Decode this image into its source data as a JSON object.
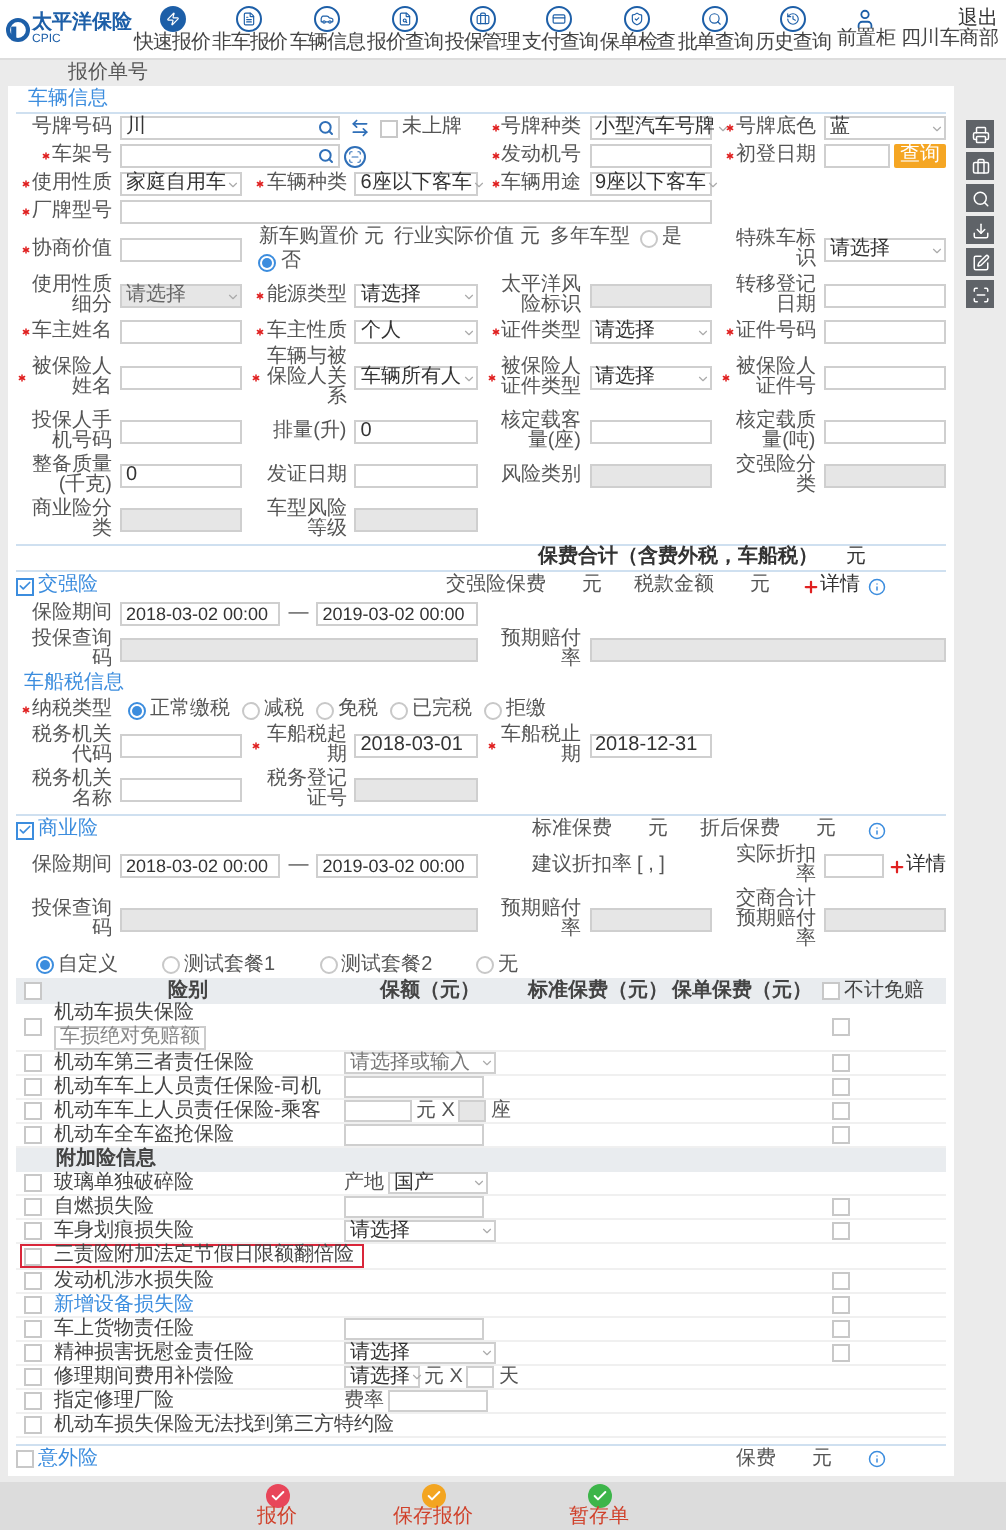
{
  "header": {
    "logo_text": "太平洋保险",
    "logo_sub": "CPIC",
    "nav": [
      {
        "label": "快速报价",
        "selected": true
      },
      {
        "label": "非车报价",
        "selected": false
      },
      {
        "label": "车辆信息",
        "selected": false
      },
      {
        "label": "报价查询",
        "selected": false
      },
      {
        "label": "投保管理",
        "selected": false
      },
      {
        "label": "支付查询",
        "selected": false
      },
      {
        "label": "保单检查",
        "selected": false
      },
      {
        "label": "批单查询",
        "selected": false
      },
      {
        "label": "历史查询",
        "selected": false
      }
    ],
    "user_label": "前置柜",
    "logout": "退出",
    "org": "四川车商部"
  },
  "quote_no_label": "报价单号",
  "vehicle": {
    "tab": "车辆信息",
    "rows": [
      [
        {
          "kind": "plate_lookup",
          "label": "号牌号码",
          "value": "川",
          "checkbox": {
            "label": "未上牌",
            "checked": false
          }
        },
        {
          "kind": "select",
          "label": "号牌种类",
          "required": true,
          "value": "小型汽车号牌"
        },
        {
          "kind": "select",
          "label": "号牌底色",
          "required": true,
          "value": "蓝"
        }
      ],
      [
        {
          "kind": "vin_lookup",
          "label": "车架号",
          "required": true
        },
        {
          "kind": "input",
          "label": "发动机号",
          "required": true
        },
        {
          "kind": "input",
          "label": "初登日期",
          "required": true,
          "button": "查询"
        }
      ],
      [
        {
          "kind": "select",
          "label": "使用性质",
          "required": true,
          "value": "家庭自用车"
        },
        {
          "kind": "select",
          "label": "车辆种类",
          "required": true,
          "value": "6座以下客车"
        },
        {
          "kind": "select",
          "label": "车辆用途",
          "required": true,
          "value": "9座以下客车"
        }
      ],
      [
        {
          "kind": "wide",
          "label": "厂牌型号",
          "required": true
        }
      ],
      [
        {
          "kind": "input",
          "label": "协商价值",
          "required": true
        },
        {
          "kind": "inline",
          "parts": [
            "新车购置价 元",
            "行业实际价值 元"
          ],
          "radio_label": "多年车型",
          "options": [
            {
              "label": "是",
              "selected": false
            },
            {
              "label": "否",
              "selected": true
            }
          ]
        },
        {
          "kind": "select",
          "label": "特殊车标识",
          "value": "请选择"
        }
      ],
      [
        {
          "kind": "select",
          "label": "使用性质细分",
          "value": "请选择",
          "disabled": true
        },
        {
          "kind": "select",
          "label": "能源类型",
          "required": true,
          "value": "请选择"
        },
        {
          "kind": "readonly",
          "label": "太平洋风险标识"
        },
        {
          "kind": "input",
          "label": "转移登记日期"
        }
      ],
      [
        {
          "kind": "input",
          "label": "车主姓名",
          "required": true
        },
        {
          "kind": "select",
          "label": "车主性质",
          "required": true,
          "value": "个人"
        },
        {
          "kind": "select",
          "label": "证件类型",
          "required": true,
          "value": "请选择"
        },
        {
          "kind": "input",
          "label": "证件号码",
          "required": true
        }
      ],
      [
        {
          "kind": "input",
          "label": "被保险人姓名",
          "required": true
        },
        {
          "kind": "select",
          "label": "车辆与被保险人关系",
          "required": true,
          "value": "车辆所有人"
        },
        {
          "kind": "select",
          "label": "被保险人证件类型",
          "required": true,
          "value": "请选择"
        },
        {
          "kind": "input",
          "label": "被保险人证件号",
          "required": true
        }
      ],
      [
        {
          "kind": "input",
          "label": "投保人手机号码"
        },
        {
          "kind": "input",
          "label": "排量(升)",
          "value": "0"
        },
        {
          "kind": "input",
          "label": "核定载客量(座)"
        },
        {
          "kind": "input",
          "label": "核定载质量(吨)"
        }
      ],
      [
        {
          "kind": "input",
          "label": "整备质量(千克)",
          "value": "0"
        },
        {
          "kind": "input",
          "label": "发证日期"
        },
        {
          "kind": "readonly",
          "label": "风险类别"
        },
        {
          "kind": "readonly",
          "label": "交强险分类"
        }
      ],
      [
        {
          "kind": "readonly",
          "label": "商业险分类"
        },
        {
          "kind": "readonly",
          "label": "车型风险等级"
        }
      ]
    ]
  },
  "total": {
    "label": "保费合计（含费外税，车船税）",
    "unit": "元"
  },
  "compulsory": {
    "checked": true,
    "title": "交强险",
    "summary": [
      {
        "label": "交强险保费",
        "unit": "元"
      },
      {
        "label": "税款金额",
        "unit": "元"
      }
    ],
    "detail": "详情",
    "rows": [
      [
        {
          "kind": "period",
          "label": "保险期间",
          "start": "2018-03-02 00:00",
          "separator": "—",
          "end": "2019-03-02 00:00"
        }
      ],
      [
        {
          "kind": "readonly2",
          "label": "投保查询码"
        },
        {
          "kind": "readonly2",
          "label": "预期赔付率"
        }
      ]
    ],
    "tax_title": "车船税信息",
    "tax_rows": [
      [
        {
          "kind": "radios",
          "label": "纳税类型",
          "required": true,
          "options": [
            {
              "label": "正常缴税",
              "selected": true
            },
            {
              "label": "减税",
              "selected": false
            },
            {
              "label": "免税",
              "selected": false
            },
            {
              "label": "已完税",
              "selected": false
            },
            {
              "label": "拒缴",
              "selected": false
            }
          ]
        }
      ],
      [
        {
          "kind": "input",
          "label": "税务机关代码"
        },
        {
          "kind": "input",
          "label": "车船税起期",
          "required": true,
          "value": "2018-03-01"
        },
        {
          "kind": "input",
          "label": "车船税止期",
          "required": true,
          "value": "2018-12-31"
        }
      ],
      [
        {
          "kind": "input",
          "label": "税务机关名称"
        },
        {
          "kind": "readonly",
          "label": "税务登记证号"
        }
      ]
    ]
  },
  "commercial": {
    "checked": true,
    "title": "商业险",
    "summary": [
      {
        "label": "标准保费",
        "unit": "元"
      },
      {
        "label": "折后保费",
        "unit": "元"
      }
    ],
    "rows": [
      [
        {
          "kind": "period",
          "label": "保险期间",
          "start": "2018-03-02 00:00",
          "separator": "—",
          "end": "2019-03-02 00:00"
        },
        {
          "kind": "text",
          "label": "建议折扣率 [ , ]"
        },
        {
          "kind": "input",
          "label": "实际折扣率",
          "detail": "详情"
        }
      ],
      [
        {
          "kind": "readonly2",
          "label": "投保查询码"
        },
        {
          "kind": "readonly",
          "label": "预期赔付率"
        },
        {
          "kind": "readonly",
          "label": "交商合计预期赔付率"
        }
      ]
    ],
    "plans": [
      {
        "label": "自定义",
        "selected": true
      },
      {
        "label": "测试套餐1",
        "selected": false
      },
      {
        "label": "测试套餐2",
        "selected": false
      },
      {
        "label": "无",
        "selected": false
      }
    ],
    "table": {
      "columns": [
        "险别",
        "保额（元）",
        "标准保费（元）",
        "保单保费（元）"
      ],
      "deductible_label": "不计免赔",
      "all_checked": false,
      "deductible_all": false,
      "rows": [
        {
          "kind": "coverage",
          "name": "机动车损失保险",
          "checked": false,
          "sub_button": "车损绝对免赔额",
          "deductible": false
        },
        {
          "kind": "coverage",
          "name": "机动车第三者责任保险",
          "checked": false,
          "field": {
            "kind": "select",
            "placeholder": "请选择或输入"
          },
          "deductible": false
        },
        {
          "kind": "coverage",
          "name": "机动车车上人员责任保险-司机",
          "checked": false,
          "field": {
            "kind": "input"
          },
          "deductible": false
        },
        {
          "kind": "coverage",
          "name": "机动车车上人员责任保险-乘客",
          "checked": false,
          "field": {
            "kind": "multiply",
            "unit": "元 X",
            "suffix": "座",
            "disabled": true
          },
          "deductible": false
        },
        {
          "kind": "coverage",
          "name": "机动车全车盗抢保险",
          "checked": false,
          "field": {
            "kind": "input"
          },
          "deductible": false
        },
        {
          "kind": "group",
          "name": "附加险信息"
        },
        {
          "kind": "coverage",
          "name": "玻璃单独破碎险",
          "checked": false,
          "field": {
            "kind": "labeled_select",
            "label": "产地",
            "value": "国产"
          }
        },
        {
          "kind": "coverage",
          "name": "自燃损失险",
          "checked": false,
          "field": {
            "kind": "input"
          },
          "deductible": false
        },
        {
          "kind": "coverage",
          "name": "车身划痕损失险",
          "checked": false,
          "field": {
            "kind": "select",
            "value": "请选择"
          },
          "deductible": false
        },
        {
          "kind": "coverage",
          "name": "三责险附加法定节假日限额翻倍险",
          "checked": false,
          "highlighted": true
        },
        {
          "kind": "coverage",
          "name": "发动机涉水损失险",
          "checked": false,
          "deductible": false
        },
        {
          "kind": "coverage",
          "name": "新增设备损失险",
          "checked": false,
          "link": true,
          "deductible": false
        },
        {
          "kind": "coverage",
          "name": "车上货物责任险",
          "checked": false,
          "field": {
            "kind": "input"
          },
          "deductible": false
        },
        {
          "kind": "coverage",
          "name": "精神损害抚慰金责任险",
          "checked": false,
          "field": {
            "kind": "select",
            "value": "请选择"
          },
          "deductible": false
        },
        {
          "kind": "coverage",
          "name": "修理期间费用补偿险",
          "checked": false,
          "field": {
            "kind": "select_multiply",
            "value": "请选择",
            "unit": "元 X",
            "suffix": "天"
          }
        },
        {
          "kind": "coverage",
          "name": "指定修理厂险",
          "checked": false,
          "field": {
            "kind": "labeled_input",
            "label": "费率"
          }
        },
        {
          "kind": "coverage",
          "name": "机动车损失保险无法找到第三方特约险",
          "checked": false
        }
      ]
    }
  },
  "accident": {
    "checked": false,
    "title": "意外险",
    "premium_label": "保费",
    "unit": "元"
  },
  "footer": [
    {
      "label": "报价",
      "color": "#e8465a"
    },
    {
      "label": "保存报价",
      "color": "#f3a521"
    },
    {
      "label": "暂存单",
      "color": "#3db54a"
    }
  ]
}
